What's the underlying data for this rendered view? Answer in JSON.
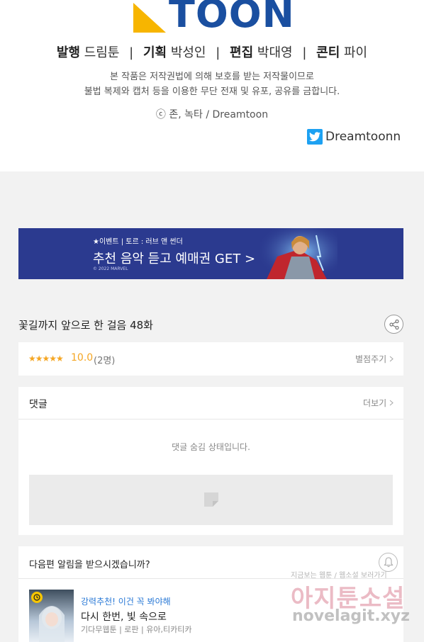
{
  "credits": {
    "logo_text": "TOON",
    "staff": [
      {
        "role": "발행",
        "name": "드림툰"
      },
      {
        "role": "기획",
        "name": "박성인"
      },
      {
        "role": "편집",
        "name": "박대영"
      },
      {
        "role": "콘티",
        "name": "파이"
      }
    ],
    "separator": "|",
    "notice_line1": "본 작품은 저작권법에 의해 보호를 받는 저작물이므로",
    "notice_line2": "불법 복제와 캡처 등을 이용한 무단 전재 및 유포, 공유를 금합니다.",
    "copyright": "ⓒ 존, 녹타 / Dreamtoon",
    "twitter_handle": "Dreamtoonn"
  },
  "banner": {
    "subtitle": "★이벤트 | 토르 : 러브 앤 썬더",
    "title": "추천 음악 듣고 예매권 GET >",
    "small": "© 2022 MARVEL",
    "bg_color": "#2b3a8f"
  },
  "episode": {
    "title": "꽃길까지 앞으로 한 걸음 48화"
  },
  "rating": {
    "stars": "★★★★★",
    "score": "10.0",
    "count": "(2명)",
    "rate_label": "별점주기",
    "star_color": "#f5a623"
  },
  "comments": {
    "label": "댓글",
    "more_label": "더보기",
    "hidden_message": "댓글 숨김 상태입니다."
  },
  "alert": {
    "question": "다음편 알림을 받으시겠습니까?",
    "rec_tag": "강력추천! 이건 꼭 봐야해",
    "rec_title": "다시 한번, 빛 속으로",
    "rec_meta": "기다무웹툰 | 로판 | 유아,티카티카",
    "tag_color": "#2a79d6"
  },
  "watermark": {
    "top": "지금보는 웹툰 / 웹소설 보러가기",
    "main": "아지툰소설",
    "url": "novelagit.xyz"
  }
}
